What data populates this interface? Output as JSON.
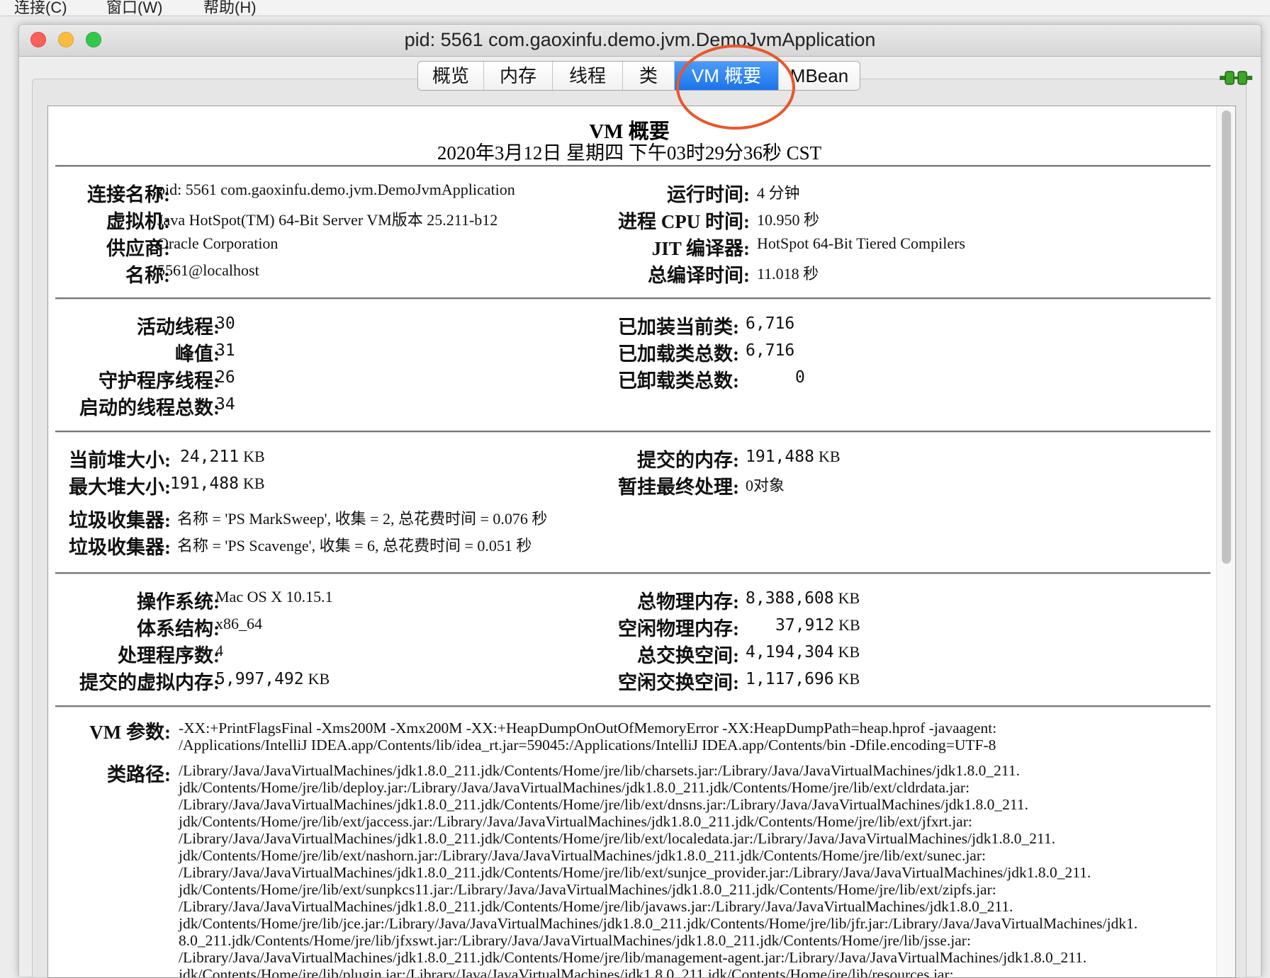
{
  "menubar": {
    "items": [
      "连接(C)",
      "窗口(W)",
      "帮助(H)"
    ]
  },
  "window": {
    "title": "pid: 5561 com.gaoxinfu.demo.jvm.DemoJvmApplication"
  },
  "tabs": [
    {
      "label": "概览",
      "active": false
    },
    {
      "label": "内存",
      "active": false
    },
    {
      "label": "线程",
      "active": false
    },
    {
      "label": "类",
      "active": false
    },
    {
      "label": "VM 概要",
      "active": true
    },
    {
      "label": "MBean",
      "active": false
    }
  ],
  "colors": {
    "active_tab": "#1a73ea",
    "annotation_circle": "#e8572c"
  },
  "header": {
    "title": "VM 概要",
    "date": "2020年3月12日 星期四 下午03时29分36秒 CST"
  },
  "section1": {
    "left": [
      {
        "label": "连接名称:",
        "value": "pid: 5561 com.gaoxinfu.demo.jvm.DemoJvmApplication"
      },
      {
        "label": "虚拟机:",
        "value": "Java HotSpot(TM) 64-Bit Server VM版本 25.211-b12"
      },
      {
        "label": "供应商:",
        "value": "Oracle Corporation"
      },
      {
        "label": "名称:",
        "value": "5561@localhost"
      }
    ],
    "right": [
      {
        "label": "运行时间:",
        "value": "4 分钟"
      },
      {
        "label": "进程 CPU 时间:",
        "value": "10.950 秒"
      },
      {
        "label": "JIT 编译器:",
        "value": "HotSpot 64-Bit Tiered Compilers"
      },
      {
        "label": "总编译时间:",
        "value": "11.018 秒"
      }
    ]
  },
  "section2": {
    "left": [
      {
        "label": "活动线程:",
        "value": "30"
      },
      {
        "label": "峰值:",
        "value": "31"
      },
      {
        "label": "守护程序线程:",
        "value": "26"
      },
      {
        "label": "启动的线程总数:",
        "value": "34"
      }
    ],
    "right": [
      {
        "label": "已加装当前类:",
        "value": "6,716"
      },
      {
        "label": "已加载类总数:",
        "value": "6,716"
      },
      {
        "label": "已卸载类总数:",
        "value": "0"
      }
    ]
  },
  "section3": {
    "current_heap": {
      "label": "当前堆大小:",
      "value": "24,211",
      "unit": "KB"
    },
    "max_heap": {
      "label": "最大堆大小:",
      "value": "191,488",
      "unit": "KB"
    },
    "committed": {
      "label": "提交的内存:",
      "value": "191,488",
      "unit": "KB"
    },
    "pending_final": {
      "label": "暂挂最终处理:",
      "value": "0对象"
    },
    "gc": [
      {
        "label": "垃圾收集器:",
        "value": "名称 = 'PS MarkSweep', 收集 = 2, 总花费时间 = 0.076 秒"
      },
      {
        "label": "垃圾收集器:",
        "value": "名称 = 'PS Scavenge', 收集 = 6, 总花费时间 = 0.051 秒"
      }
    ]
  },
  "section4": {
    "left": [
      {
        "label": "操作系统:",
        "value": "Mac OS X 10.15.1"
      },
      {
        "label": "体系结构:",
        "value": "x86_64"
      },
      {
        "label": "处理程序数:",
        "value": "4"
      },
      {
        "label": "提交的虚拟内存:",
        "value": "5,997,492",
        "unit": "KB"
      }
    ],
    "right": [
      {
        "label": "总物理内存:",
        "value": "8,388,608",
        "unit": "KB"
      },
      {
        "label": "空闲物理内存:",
        "value": "37,912",
        "unit": "KB"
      },
      {
        "label": "总交换空间:",
        "value": "4,194,304",
        "unit": "KB"
      },
      {
        "label": "空闲交换空间:",
        "value": "1,117,696",
        "unit": "KB"
      }
    ]
  },
  "section5": {
    "vm_args_label": "VM 参数:",
    "vm_args": "-XX:+PrintFlagsFinal -Xms200M -Xmx200M -XX:+HeapDumpOnOutOfMemoryError -XX:HeapDumpPath=heap.hprof -javaagent:\n/Applications/IntelliJ IDEA.app/Contents/lib/idea_rt.jar=59045:/Applications/IntelliJ IDEA.app/Contents/bin -Dfile.encoding=UTF-8",
    "classpath_label": "类路径:",
    "classpath": "/Library/Java/JavaVirtualMachines/jdk1.8.0_211.jdk/Contents/Home/jre/lib/charsets.jar:/Library/Java/JavaVirtualMachines/jdk1.8.0_211.\njdk/Contents/Home/jre/lib/deploy.jar:/Library/Java/JavaVirtualMachines/jdk1.8.0_211.jdk/Contents/Home/jre/lib/ext/cldrdata.jar:\n/Library/Java/JavaVirtualMachines/jdk1.8.0_211.jdk/Contents/Home/jre/lib/ext/dnsns.jar:/Library/Java/JavaVirtualMachines/jdk1.8.0_211.\njdk/Contents/Home/jre/lib/ext/jaccess.jar:/Library/Java/JavaVirtualMachines/jdk1.8.0_211.jdk/Contents/Home/jre/lib/ext/jfxrt.jar:\n/Library/Java/JavaVirtualMachines/jdk1.8.0_211.jdk/Contents/Home/jre/lib/ext/localedata.jar:/Library/Java/JavaVirtualMachines/jdk1.8.0_211.\njdk/Contents/Home/jre/lib/ext/nashorn.jar:/Library/Java/JavaVirtualMachines/jdk1.8.0_211.jdk/Contents/Home/jre/lib/ext/sunec.jar:\n/Library/Java/JavaVirtualMachines/jdk1.8.0_211.jdk/Contents/Home/jre/lib/ext/sunjce_provider.jar:/Library/Java/JavaVirtualMachines/jdk1.8.0_211.\njdk/Contents/Home/jre/lib/ext/sunpkcs11.jar:/Library/Java/JavaVirtualMachines/jdk1.8.0_211.jdk/Contents/Home/jre/lib/ext/zipfs.jar:\n/Library/Java/JavaVirtualMachines/jdk1.8.0_211.jdk/Contents/Home/jre/lib/javaws.jar:/Library/Java/JavaVirtualMachines/jdk1.8.0_211.\njdk/Contents/Home/jre/lib/jce.jar:/Library/Java/JavaVirtualMachines/jdk1.8.0_211.jdk/Contents/Home/jre/lib/jfr.jar:/Library/Java/JavaVirtualMachines/jdk1.\n8.0_211.jdk/Contents/Home/jre/lib/jfxswt.jar:/Library/Java/JavaVirtualMachines/jdk1.8.0_211.jdk/Contents/Home/jre/lib/jsse.jar:\n/Library/Java/JavaVirtualMachines/jdk1.8.0_211.jdk/Contents/Home/jre/lib/management-agent.jar:/Library/Java/JavaVirtualMachines/jdk1.8.0_211.\njdk/Contents/Home/jre/lib/plugin.jar:/Library/Java/JavaVirtualMachines/jdk1.8.0_211.jdk/Contents/Home/jre/lib/resources.jar:"
  }
}
